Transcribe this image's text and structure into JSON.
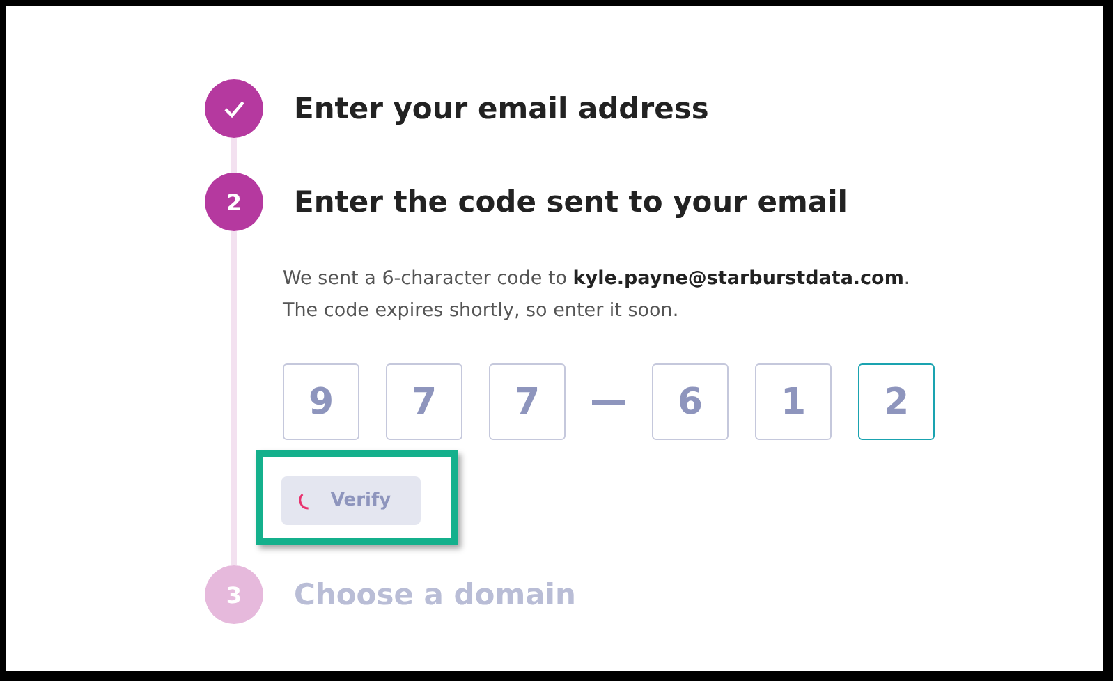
{
  "steps": [
    {
      "kind": "done",
      "title": "Enter your email address"
    },
    {
      "kind": "current",
      "number": "2",
      "title": "Enter the code sent to your email",
      "message": [
        "We sent a 6-character code to **kyle.payne@starburstdata.com**.",
        "The code expires shortly, so enter it soon."
      ],
      "code_groups": [
        {
          "digits": [
            {
              "value": "9",
              "focused": false
            },
            {
              "value": "7",
              "focused": false
            },
            {
              "value": "7",
              "focused": false
            }
          ]
        },
        {
          "digits": [
            {
              "value": "6",
              "focused": false
            },
            {
              "value": "1",
              "focused": false
            },
            {
              "value": "2",
              "focused": true
            }
          ]
        }
      ],
      "button": {
        "label": "Verify",
        "loading": true,
        "highlighted": true
      }
    },
    {
      "kind": "upcoming",
      "number": "3",
      "title": "Choose a domain"
    }
  ]
}
